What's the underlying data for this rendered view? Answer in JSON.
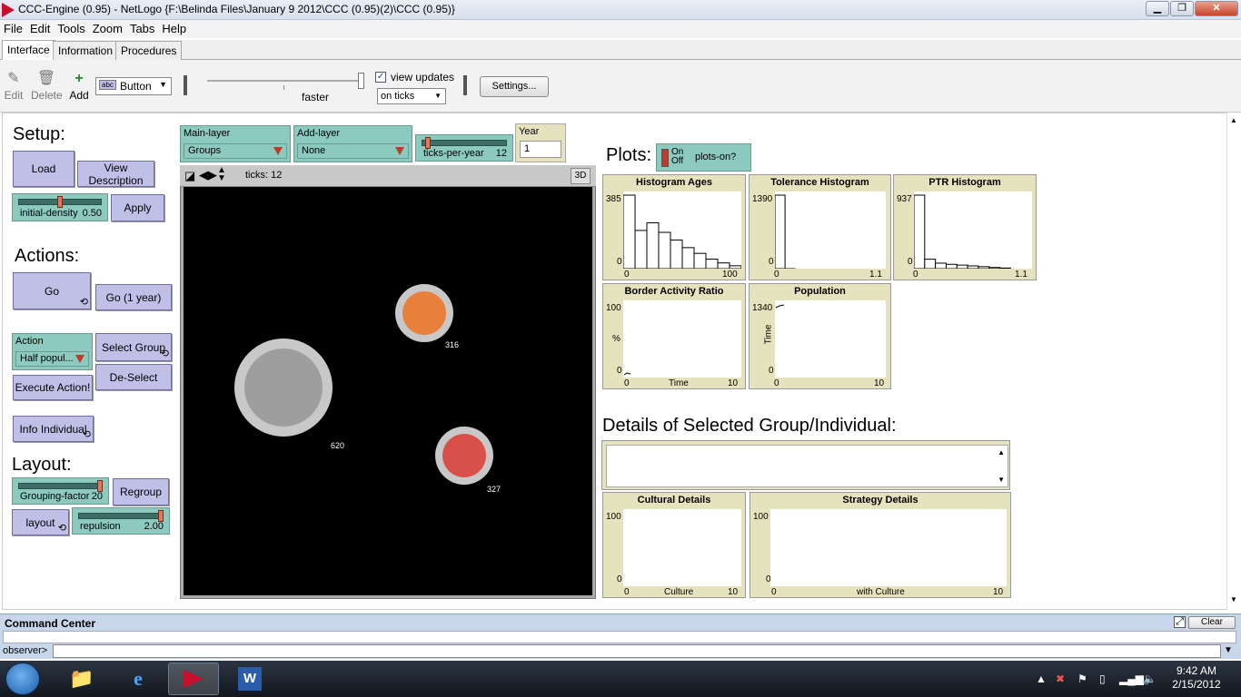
{
  "window": {
    "title": "CCC-Engine (0.95) - NetLogo {F:\\Belinda Files\\January 9 2012\\CCC (0.95)(2)\\CCC (0.95)}",
    "minimize_label": "▁",
    "restore_label": "❐",
    "close_label": "✕"
  },
  "menu": [
    "File",
    "Edit",
    "Tools",
    "Zoom",
    "Tabs",
    "Help"
  ],
  "tabs": [
    "Interface",
    "Information",
    "Procedures"
  ],
  "toolbar": {
    "edit_label": "Edit",
    "delete_label": "Delete",
    "add_label": "Add",
    "widget_type": "Button",
    "speed_label": "faster",
    "view_updates_label": "view updates",
    "view_updates_checked": true,
    "update_mode": "on ticks",
    "settings_label": "Settings..."
  },
  "setup": {
    "heading": "Setup:",
    "load_label": "Load",
    "view_description_label": "View Description",
    "initial_density_label": "initial-density",
    "initial_density_value": "0.50",
    "initial_density_fraction": 0.5,
    "apply_label": "Apply"
  },
  "actions": {
    "heading": "Actions:",
    "go_label": "Go",
    "go_year_label": "Go (1 year)",
    "action_chooser_label": "Action",
    "action_chooser_value": "Half popul...",
    "select_group_label": "Select Group",
    "deselect_label": "De-Select",
    "execute_label": "Execute Action!",
    "info_individual_label": "Info Individual"
  },
  "layout": {
    "heading": "Layout:",
    "grouping_factor_label": "Grouping-factor",
    "grouping_factor_value": "20",
    "grouping_factor_fraction": 1.0,
    "regroup_label": "Regroup",
    "layout_label": "layout",
    "repulsion_label": "repulsion",
    "repulsion_value": "2.00",
    "repulsion_fraction": 1.0
  },
  "world_controls": {
    "main_layer_label": "Main-layer",
    "main_layer_value": "Groups",
    "add_layer_label": "Add-layer",
    "add_layer_value": "None",
    "ticks_per_year_label": "ticks-per-year",
    "ticks_per_year_value": "12",
    "ticks_per_year_fraction": 0.05,
    "year_label": "Year",
    "year_value": "1"
  },
  "view": {
    "ticks_label": "ticks: 12",
    "three_d_label": "3D",
    "groups": [
      {
        "label": "316",
        "color": "#e8803c"
      },
      {
        "label": "620",
        "color": "#9e9e9e"
      },
      {
        "label": "327",
        "color": "#d9504a"
      }
    ]
  },
  "plots_section": {
    "heading": "Plots:",
    "switch_on": "On",
    "switch_off": "Off",
    "switch_label": "plots-on?"
  },
  "plots": {
    "histogram_ages": {
      "title": "Histogram Ages",
      "ymax": "385",
      "ymin": "0",
      "xmin": "0",
      "xmax": "100",
      "xlabel": ""
    },
    "tolerance_histogram": {
      "title": "Tolerance Histogram",
      "ymax": "1390",
      "ymin": "0",
      "xmin": "0",
      "xmax": "1.1"
    },
    "ptr_histogram": {
      "title": "PTR Histogram",
      "ymax": "937",
      "ymin": "0",
      "xmin": "0",
      "xmax": "1.1"
    },
    "border_activity": {
      "title": "Border Activity Ratio",
      "ymax": "100",
      "ymin": "0",
      "xmin": "0",
      "xmax": "10",
      "xlabel": "Time",
      "ylabel": "%"
    },
    "population": {
      "title": "Population",
      "ymax": "1340",
      "ymin": "0",
      "xmin": "0",
      "xmax": "10",
      "ylabel": "Time"
    },
    "cultural_details": {
      "title": "Cultural Details",
      "ymax": "100",
      "ymin": "0",
      "xmin": "0",
      "xmax": "10",
      "xlabel": "Culture"
    },
    "strategy_details": {
      "title": "Strategy Details",
      "ymax": "100",
      "ymin": "0",
      "xmin": "0",
      "xmax": "10",
      "xlabel": "with Culture"
    }
  },
  "details": {
    "heading": "Details of Selected Group/Individual:"
  },
  "command_center": {
    "title": "Command Center",
    "clear_label": "Clear",
    "prompt": "observer>"
  },
  "taskbar": {
    "time": "9:42 AM",
    "date": "2/15/2012"
  },
  "chart_data": [
    {
      "type": "bar",
      "title": "Histogram Ages",
      "x": [
        0,
        10,
        20,
        30,
        40,
        50,
        60,
        70,
        80,
        90
      ],
      "values": [
        385,
        200,
        240,
        190,
        150,
        110,
        80,
        50,
        30,
        15
      ],
      "xlim": [
        0,
        100
      ],
      "ylim": [
        0,
        385
      ]
    },
    {
      "type": "bar",
      "title": "Tolerance Histogram",
      "x": [
        0,
        0.1
      ],
      "values": [
        1390,
        0
      ],
      "xlim": [
        0,
        1.1
      ],
      "ylim": [
        0,
        1390
      ]
    },
    {
      "type": "bar",
      "title": "PTR Histogram",
      "x": [
        0,
        0.1,
        0.2,
        0.3,
        0.4,
        0.5,
        0.6,
        0.7,
        0.8
      ],
      "values": [
        937,
        120,
        70,
        55,
        45,
        35,
        25,
        15,
        8
      ],
      "xlim": [
        0,
        1.1
      ],
      "ylim": [
        0,
        937
      ]
    }
  ]
}
